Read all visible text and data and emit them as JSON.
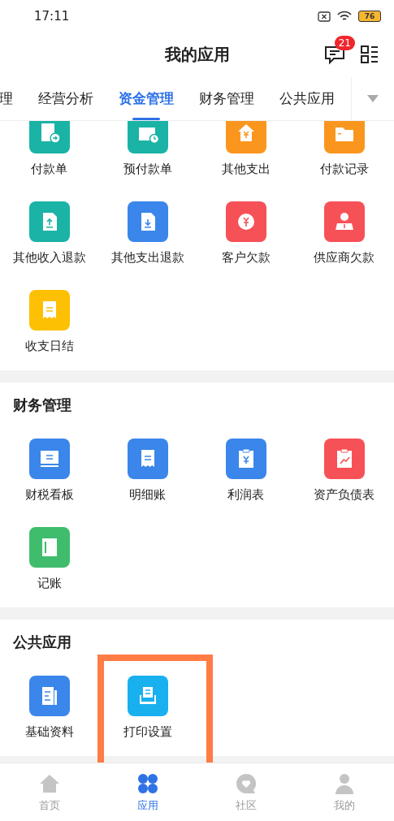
{
  "status_bar": {
    "time": "17:11",
    "battery": "76"
  },
  "header": {
    "title": "我的应用",
    "badge": "21"
  },
  "tabs": [
    {
      "label": "理",
      "selected": false
    },
    {
      "label": "经营分析",
      "selected": false
    },
    {
      "label": "资金管理",
      "selected": true
    },
    {
      "label": "财务管理",
      "selected": false
    },
    {
      "label": "公共应用",
      "selected": false
    }
  ],
  "sections": [
    {
      "apps": [
        {
          "label": "付款单",
          "kind": "doc-arrow",
          "color": "#1ab3a6",
          "highlighted": false
        },
        {
          "label": "预付款单",
          "kind": "wallet",
          "color": "#1ab3a6",
          "highlighted": false
        },
        {
          "label": "其他支出",
          "kind": "house",
          "color": "#fa961e",
          "highlighted": false
        },
        {
          "label": "付款记录",
          "kind": "folder",
          "color": "#fa961e",
          "highlighted": false
        },
        {
          "label": "其他收入退款",
          "kind": "upload",
          "color": "#1ab3a6",
          "highlighted": false
        },
        {
          "label": "其他支出退款",
          "kind": "download",
          "color": "#3a86ea",
          "highlighted": false
        },
        {
          "label": "客户欠款",
          "kind": "coin",
          "color": "#f65157",
          "highlighted": false
        },
        {
          "label": "供应商欠款",
          "kind": "person",
          "color": "#f65157",
          "highlighted": false
        },
        {
          "label": "收支日结",
          "kind": "receipt",
          "color": "#fdc003",
          "highlighted": false
        }
      ]
    },
    {
      "title": "财务管理",
      "apps": [
        {
          "label": "财税看板",
          "kind": "board",
          "color": "#3a86ea",
          "highlighted": false
        },
        {
          "label": "明细账",
          "kind": "receipt",
          "color": "#3a86ea",
          "highlighted": false
        },
        {
          "label": "利润表",
          "kind": "clipboard",
          "color": "#3a86ea",
          "highlighted": false
        },
        {
          "label": "资产负债表",
          "kind": "chart",
          "color": "#f65157",
          "highlighted": false
        },
        {
          "label": "记账",
          "kind": "book",
          "color": "#3fbd6c",
          "highlighted": false
        }
      ]
    },
    {
      "title": "公共应用",
      "apps": [
        {
          "label": "基础资料",
          "kind": "document",
          "color": "#3a86ea",
          "highlighted": false
        },
        {
          "label": "打印设置",
          "kind": "printer",
          "color": "#19b0ef",
          "highlighted": true
        }
      ]
    }
  ],
  "bottom_nav": [
    {
      "label": "首页",
      "kind": "home",
      "selected": false
    },
    {
      "label": "应用",
      "kind": "apps",
      "selected": true
    },
    {
      "label": "社区",
      "kind": "chat-heart",
      "selected": false
    },
    {
      "label": "我的",
      "kind": "user",
      "selected": false
    }
  ]
}
